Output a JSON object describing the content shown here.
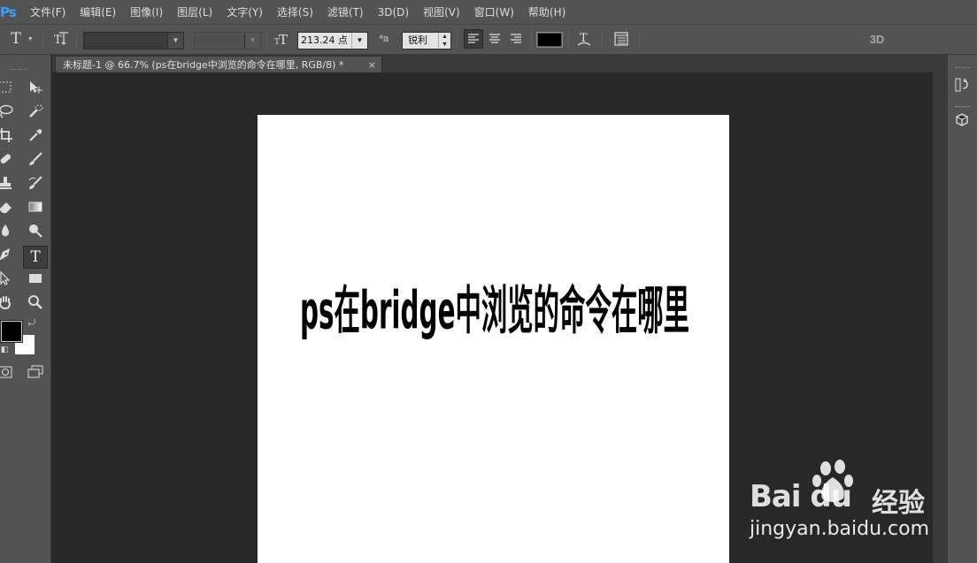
{
  "app": {
    "logo": "Ps",
    "menu": [
      "文件(F)",
      "编辑(E)",
      "图像(I)",
      "图层(L)",
      "文字(Y)",
      "选择(S)",
      "滤镜(T)",
      "3D(D)",
      "视图(V)",
      "窗口(W)",
      "帮助(H)"
    ]
  },
  "options": {
    "tool_glyph": "T",
    "font_family": "",
    "font_style": "",
    "font_size": "213.24 点",
    "antialias_label": "ªa",
    "antialias_value": "锐利",
    "text_color": "#000000",
    "mode_3d": "3D"
  },
  "document": {
    "tab_title": "未标题-1 @ 66.7% (ps在bridge中浏览的命令在哪里, RGB/8) *",
    "tab_close": "×",
    "canvas_text": "ps在bridge中浏览的命令在哪里"
  },
  "colors": {
    "foreground": "#000000",
    "background": "#ffffff",
    "accent": "#3aa0ff"
  },
  "watermark": {
    "brand": "Bai du",
    "cn": "经验",
    "url": "jingyan.baidu.com"
  }
}
